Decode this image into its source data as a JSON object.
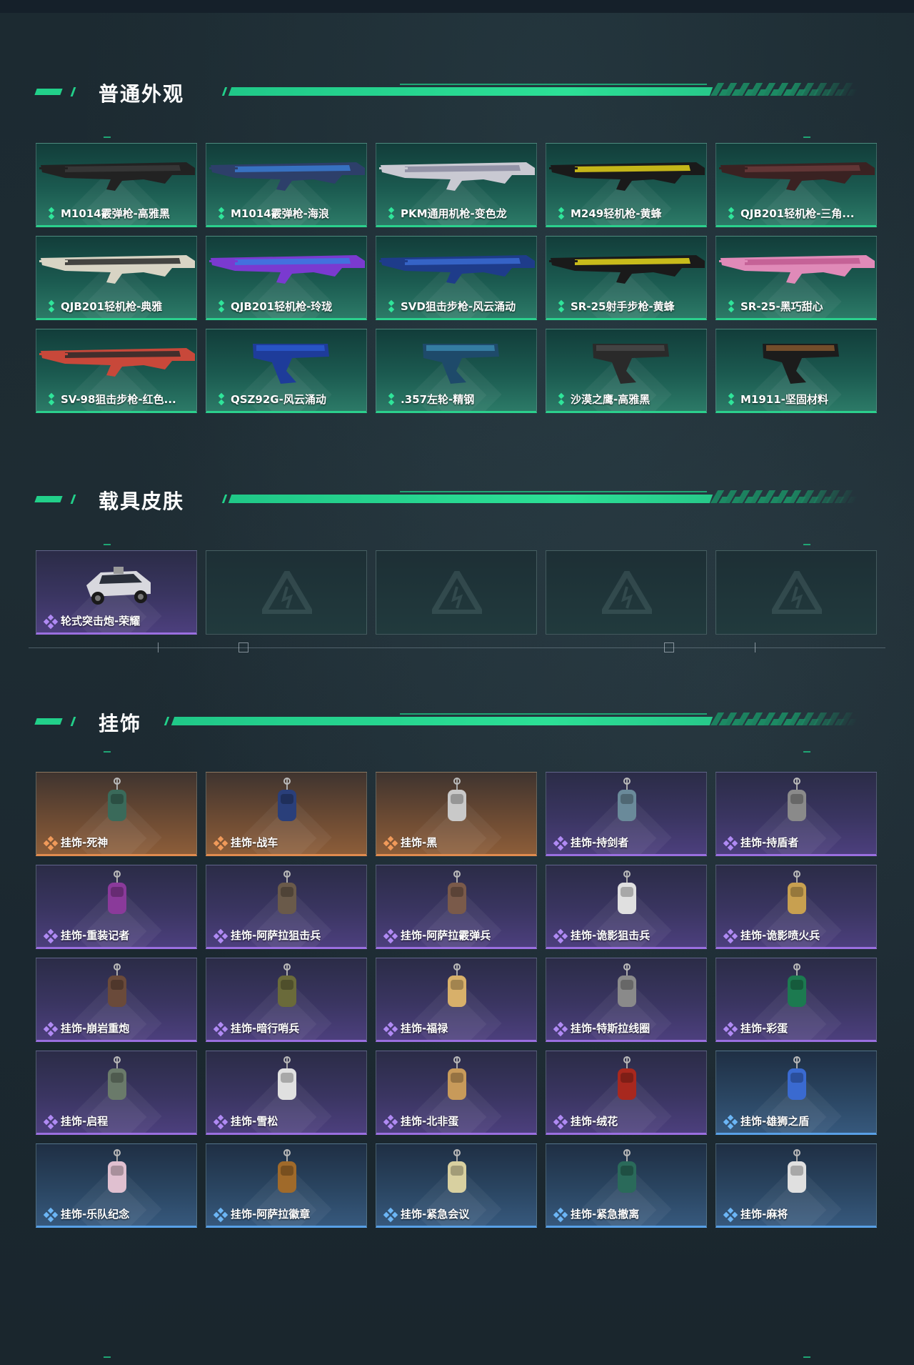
{
  "sections": {
    "weapon": {
      "title": "普通外观",
      "items": [
        {
          "name": "M1014霰弹枪-高雅黑",
          "icon": "shotgun-black-icon"
        },
        {
          "name": "M1014霰弹枪-海浪",
          "icon": "shotgun-wave-icon"
        },
        {
          "name": "PKM通用机枪-变色龙",
          "icon": "machinegun-chameleon-icon"
        },
        {
          "name": "M249轻机枪-黄蜂",
          "icon": "lmg-hornet-icon"
        },
        {
          "name": "QJB201轻机枪-三角...",
          "icon": "lmg-triangle-icon"
        },
        {
          "name": "QJB201轻机枪-典雅",
          "icon": "lmg-elegant-icon"
        },
        {
          "name": "QJB201轻机枪-玲珑",
          "icon": "lmg-exquisite-icon"
        },
        {
          "name": "SVD狙击步枪-风云涌动",
          "icon": "sniper-storm-icon"
        },
        {
          "name": "SR-25射手步枪-黄蜂",
          "icon": "marksman-hornet-icon"
        },
        {
          "name": "SR-25-黑巧甜心",
          "icon": "marksman-pink-icon"
        },
        {
          "name": "SV-98狙击步枪-红色...",
          "icon": "sniper-red-icon"
        },
        {
          "name": "QSZ92G-风云涌动",
          "icon": "pistol-storm-icon"
        },
        {
          "name": ".357左轮-精钢",
          "icon": "revolver-steel-icon"
        },
        {
          "name": "沙漠之鹰-高雅黑",
          "icon": "deagle-black-icon"
        },
        {
          "name": "M1911-坚固材料",
          "icon": "pistol-wood-icon"
        }
      ]
    },
    "vehicle": {
      "title": "载具皮肤",
      "items": [
        {
          "name": "轮式突击炮-荣耀",
          "icon": "assault-vehicle-icon"
        }
      ],
      "empty_slots": 4
    },
    "pendant": {
      "title": "挂饰",
      "items": [
        {
          "name": "挂饰-死神",
          "rarity": "orange"
        },
        {
          "name": "挂饰-战车",
          "rarity": "orange"
        },
        {
          "name": "挂饰-黑",
          "rarity": "orange"
        },
        {
          "name": "挂饰-持剑者",
          "rarity": "purple"
        },
        {
          "name": "挂饰-持盾者",
          "rarity": "purple"
        },
        {
          "name": "挂饰-重装记者",
          "rarity": "purple"
        },
        {
          "name": "挂饰-阿萨拉狙击兵",
          "rarity": "purple"
        },
        {
          "name": "挂饰-阿萨拉霰弹兵",
          "rarity": "purple"
        },
        {
          "name": "挂饰-诡影狙击兵",
          "rarity": "purple"
        },
        {
          "name": "挂饰-诡影喷火兵",
          "rarity": "purple"
        },
        {
          "name": "挂饰-崩岩重炮",
          "rarity": "purple"
        },
        {
          "name": "挂饰-暗行哨兵",
          "rarity": "purple"
        },
        {
          "name": "挂饰-福禄",
          "rarity": "purple"
        },
        {
          "name": "挂饰-特斯拉线圈",
          "rarity": "purple"
        },
        {
          "name": "挂饰-彩蛋",
          "rarity": "purple"
        },
        {
          "name": "挂饰-启程",
          "rarity": "purple"
        },
        {
          "name": "挂饰-雪松",
          "rarity": "purple"
        },
        {
          "name": "挂饰-北非蛋",
          "rarity": "purple"
        },
        {
          "name": "挂饰-绒花",
          "rarity": "purple"
        },
        {
          "name": "挂饰-雄狮之盾",
          "rarity": "blue"
        },
        {
          "name": "挂饰-乐队纪念",
          "rarity": "blue"
        },
        {
          "name": "挂饰-阿萨拉徽章",
          "rarity": "blue"
        },
        {
          "name": "挂饰-紧急会议",
          "rarity": "blue"
        },
        {
          "name": "挂饰-紧急撤离",
          "rarity": "blue"
        },
        {
          "name": "挂饰-麻将",
          "rarity": "blue"
        }
      ]
    }
  },
  "colors": {
    "accent_green": "#2bd08d",
    "rarity_purple": "#9a6fe0",
    "rarity_orange": "#e08b4e",
    "rarity_blue": "#58a0e6"
  }
}
